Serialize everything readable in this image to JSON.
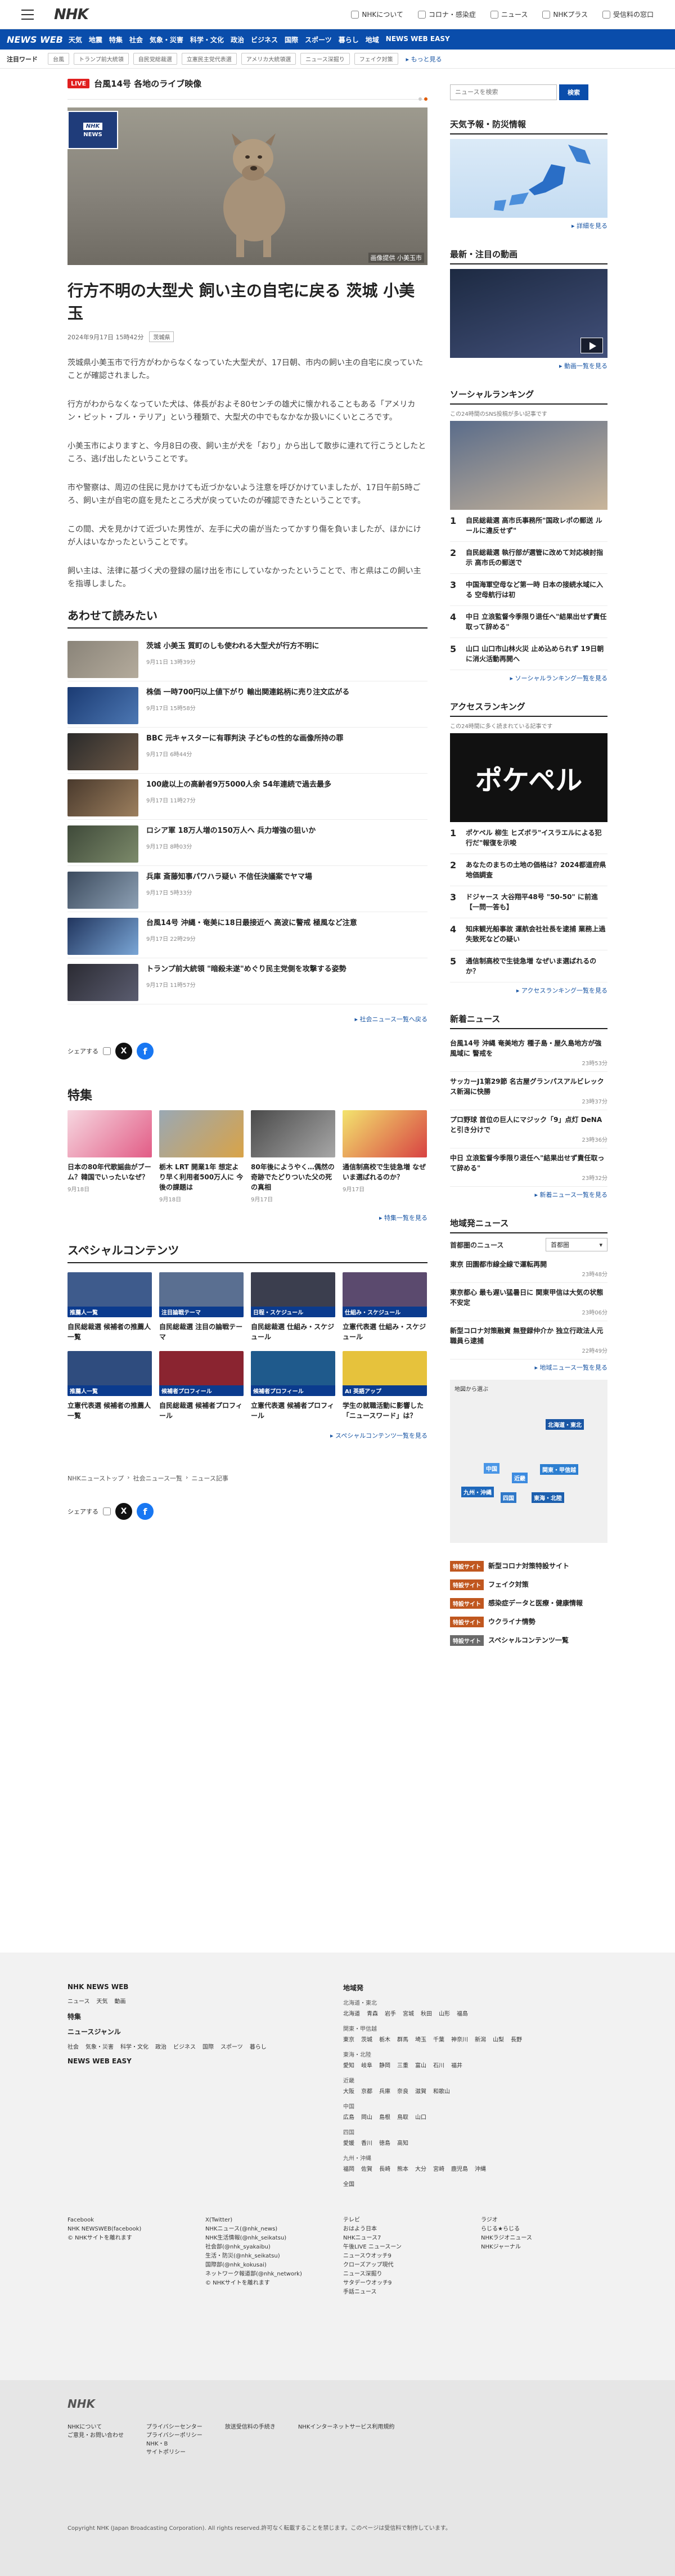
{
  "header": {
    "logo": "NHK",
    "links": [
      "NHKについて",
      "コロナ・感染症",
      "ニュース",
      "NHKプラス",
      "受信料の窓口"
    ]
  },
  "nav": {
    "logo": "NEWS WEB",
    "items": [
      "天気",
      "地震",
      "特集",
      "社会",
      "気象・災害",
      "科学・文化",
      "政治",
      "ビジネス",
      "国際",
      "スポーツ",
      "暮らし",
      "地域",
      "NEWS WEB EASY"
    ]
  },
  "trend": {
    "label": "注目ワード",
    "chips": [
      "台風",
      "トランプ前大統領",
      "自民党総裁選",
      "立憲民主党代表選",
      "アメリカ大統領選",
      "ニュース深掘り",
      "フェイク対策"
    ],
    "more": "もっと見る"
  },
  "live": {
    "badge": "LIVE",
    "title": "台風14号 各地のライブ映像"
  },
  "article": {
    "hero_credit": "画像提供 小美玉市",
    "headline": "行方不明の大型犬 飼い主の自宅に戻る 茨城 小美玉",
    "datetime": "2024年9月17日 15時42分",
    "tag": "茨城県",
    "paragraphs": [
      "茨城県小美玉市で行方がわからなくなっていた大型犬が、17日朝、市内の飼い主の自宅に戻っていたことが確認されました。",
      "行方がわからなくなっていた犬は、体長がおよそ80センチの雄犬に懐かれることもある「アメリカン・ピット・ブル・テリア」という種類で、大型犬の中でもなかなか扱いにくいところです。",
      "小美玉市によりますと、今月8日の夜、飼い主が犬を「おり」から出して散歩に連れて行こうとしたところ、逃げ出したということです。",
      "市や警察は、周辺の住民に見かけても近づかないよう注意を呼びかけていましたが、17日午前5時ごろ、飼い主が自宅の庭を見たところ犬が戻っていたのが確認できたということです。",
      "この間、犬を見かけて近づいた男性が、左手に犬の歯が当たってかすり傷を負いましたが、ほかにけが人はいなかったということです。",
      "飼い主は、法律に基づく犬の登録の届け出を市にしていなかったということで、市と県はこの飼い主を指導しました。"
    ]
  },
  "related": {
    "title": "あわせて読みたい",
    "items": [
      {
        "title": "茨城 小美玉 質町のしも使われる大型犬が行方不明に",
        "date": "9月11日 13時39分"
      },
      {
        "title": "株価 一時700円以上値下がり 輸出関連銘柄に売り注文広がる",
        "date": "9月17日 15時58分"
      },
      {
        "title": "BBC 元キャスターに有罪判決 子どもの性的な画像所持の罪",
        "date": "9月17日 6時44分"
      },
      {
        "title": "100歳以上の高齢者9万5000人余 54年連続で過去最多",
        "date": "9月17日 11時27分"
      },
      {
        "title": "ロシア軍 18万人増の150万人へ 兵力増強の狙いか",
        "date": "9月17日 8時03分"
      },
      {
        "title": "兵庫 斎藤知事パワハラ疑い 不信任決議案でヤマ場",
        "date": "9月17日 5時33分"
      },
      {
        "title": "台風14号 沖縄・奄美に18日最接近へ 高波に警戒 極風など注意",
        "date": "9月17日 22時29分"
      },
      {
        "title": "トランプ前大統領 \"暗殺未遂\"めぐり民主党側を攻撃する姿勢",
        "date": "9月17日 11時57分"
      }
    ],
    "more": "社会ニュース一覧へ戻る"
  },
  "share": {
    "label": "シェアする"
  },
  "features": {
    "title": "特集",
    "items": [
      {
        "text": "日本の80年代歌謡曲がブーム？韓国でいったいなぜ？",
        "date": "9月18日"
      },
      {
        "text": "栃木 LRT 開業1年 想定より早く利用者500万人に 今後の課題は",
        "date": "9月18日"
      },
      {
        "text": "80年後にようやく…偶然の奇跡でたどりついた父の死の真相",
        "date": "9月17日"
      },
      {
        "text": "通信制高校で生徒急増 なぜいま選ばれるのか？",
        "date": "9月17日"
      }
    ],
    "more": "特集一覧を見る"
  },
  "special": {
    "title": "スペシャルコンテンツ",
    "items": [
      {
        "overlay": "推薦人一覧",
        "text": "自民総裁選 候補者の推薦人一覧"
      },
      {
        "overlay": "注目論戦テーマ",
        "text": "自民総裁選 注目の論戦テーマ"
      },
      {
        "overlay": "日程・スケジュール",
        "text": "自民総裁選 仕組み・スケジュール"
      },
      {
        "overlay": "仕組み・スケジュール",
        "text": "立憲代表選 仕組み・スケジュール"
      },
      {
        "overlay": "推薦人一覧",
        "text": "立憲代表選 候補者の推薦人一覧"
      },
      {
        "overlay": "候補者プロフィール",
        "text": "自民総裁選 候補者プロフィール"
      },
      {
        "overlay": "候補者プロフィール",
        "text": "立憲代表選 候補者プロフィール"
      },
      {
        "overlay": "AI 英語アップ",
        "text": "学生の就職活動に影響した「ニュースワード」は？"
      }
    ],
    "more": "スペシャルコンテンツ一覧を見る"
  },
  "breadcrumb": [
    "NHKニューストップ",
    "社会ニュース一覧",
    "ニュース記事"
  ],
  "sidebar": {
    "search_placeholder": "ニュースを検索",
    "search_button": "検索",
    "weather": {
      "title": "天気予報・防災情報",
      "link": "詳細を見る"
    },
    "video": {
      "title": "最新・注目の動画",
      "link": "動画一覧を見る"
    },
    "social_ranking": {
      "title": "ソーシャルランキング",
      "sub": "この24時間のSNS投稿が多い記事です",
      "items": [
        "自民総裁選 高市氏事務所\"国政レポの郵送 ルールに違反せず\"",
        "自民総裁選 執行部が選管に改めて対応検討指示 高市氏の郵送で",
        "中国海軍空母など第一時 日本の接続水域に入る 空母航行は初",
        "中日 立浪監督今季限り退任へ\"結果出せず責任取って辞める\"",
        "山口 山口市山林火災 止め込められず 19日朝に消火活動再開へ"
      ],
      "link": "ソーシャルランキング一覧を見る"
    },
    "access_ranking": {
      "title": "アクセスランキング",
      "sub": "この24時間に多く読まれている記事です",
      "banner": "ポケペル",
      "items": [
        "ポケペル 柳生 ヒズボラ\"イスラエルによる犯行だ\"報復を示唆",
        "あなたのまちの土地の価格は？2024都道府県地価調査",
        "ドジャース 大谷翔平48号 \"50-50\" に前進【一問一答も】",
        "知床観光船事故 運航会社社長を逮捕 業務上過失致死などの疑い",
        "通信制高校で生徒急増 なぜいま選ばれるのか？"
      ],
      "link": "アクセスランキング一覧を見る"
    },
    "latest": {
      "title": "新着ニュース",
      "items": [
        {
          "t": "台風14号 沖縄 奄美地方 種子島・屋久島地方が強風域に 警戒を",
          "d": "23時53分"
        },
        {
          "t": "サッカーJ1第29節 名古屋グランパスアルビレックス新潟に快勝",
          "d": "23時37分"
        },
        {
          "t": "プロ野球 首位の巨人にマジック「9」点灯 DeNAと引き分けで",
          "d": "23時36分"
        },
        {
          "t": "中日 立浪監督今季限り退任へ\"結果出せず責任取って辞める\"",
          "d": "23時32分"
        }
      ],
      "link": "新着ニュース一覧を見る"
    },
    "local": {
      "title": "地域発ニュース",
      "label": "首都圏のニュース",
      "select": "首都圏",
      "items": [
        {
          "t": "東京 田園都市線全線で運転再開",
          "d": "23時48分"
        },
        {
          "t": "東京都心 最も遅い猛暑日に 関東甲信は大気の状態不安定",
          "d": "23時06分"
        },
        {
          "t": "新型コロナ対策融資 無登録仲介か 独立行政法人元職員ら逮捕",
          "d": "22時49分"
        }
      ],
      "link": "地域ニュース一覧を見る",
      "map_label": "地図から選ぶ",
      "regions": [
        "北海道・東北",
        "関東・甲信越",
        "近畿",
        "中国",
        "九州・沖縄",
        "四国",
        "東海・北陸"
      ]
    },
    "special_links": [
      {
        "tag": "特設サイト",
        "text": "新型コロナ対策特設サイト"
      },
      {
        "tag": "特設サイト",
        "text": "フェイク対策"
      },
      {
        "tag": "特設サイト",
        "text": "感染症データと医療・健康情報"
      },
      {
        "tag": "特設サイト",
        "text": "ウクライナ情勢"
      },
      {
        "tag": "特設サイト",
        "text": "スペシャルコンテンツ一覧"
      }
    ]
  },
  "footer": {
    "left_title": "NHK NEWS WEB",
    "left_row1": [
      "ニュース",
      "天気",
      "動画"
    ],
    "left_feat": "特集",
    "genre_title": "ニュースジャンル",
    "genres": [
      "社会",
      "気象・災害",
      "科学・文化",
      "政治",
      "ビジネス",
      "国際",
      "スポーツ",
      "暮らし"
    ],
    "easy": "NEWS WEB EASY",
    "region_title": "地域発",
    "regions": [
      {
        "h": "北海道・東北",
        "items": [
          "北海道",
          "青森",
          "岩手",
          "宮城",
          "秋田",
          "山形",
          "福島"
        ]
      },
      {
        "h": "関東・甲信越",
        "items": [
          "東京",
          "茨城",
          "栃木",
          "群馬",
          "埼玉",
          "千葉",
          "神奈川",
          "新潟",
          "山梨",
          "長野"
        ]
      },
      {
        "h": "東海・北陸",
        "items": [
          "愛知",
          "岐阜",
          "静岡",
          "三重",
          "富山",
          "石川",
          "福井"
        ]
      },
      {
        "h": "近畿",
        "items": [
          "大阪",
          "京都",
          "兵庫",
          "奈良",
          "滋賀",
          "和歌山"
        ]
      },
      {
        "h": "中国",
        "items": [
          "広島",
          "岡山",
          "島根",
          "鳥取",
          "山口"
        ]
      },
      {
        "h": "四国",
        "items": [
          "愛媛",
          "香川",
          "徳島",
          "高知"
        ]
      },
      {
        "h": "九州・沖縄",
        "items": [
          "福岡",
          "佐賀",
          "長崎",
          "熊本",
          "大分",
          "宮崎",
          "鹿児島",
          "沖縄"
        ]
      }
    ],
    "all": "全国",
    "social": [
      "Facebook\nNHK NEWSWEB(facebook)\n© NHKサイトを離れます",
      "X(Twitter)\nNHKニュース(@nhk_news)\nNHK生活情報(@nhk_seikatsu)\n社会部(@nhk_syakaibu)\n生活・防災(@nhk_seikatsu)\n国際部(@nhk_kokusai)\nネットワーク報道部(@nhk_network)\n© NHKサイトを離れます",
      "テレビ\nおはよう日本\nNHKニュース7\n午後LIVE ニュースーン\nニュースウオッチ9\nクローズアップ現代\nニュース深掘り\nサタデーウオッチ9\n手話ニュース",
      "ラジオ\nらじる★らじる\nNHKラジオニュース\nNHKジャーナル"
    ],
    "bottom_logo": "NHK",
    "bottom_links": [
      "NHKについて\nご意見・お問い合わせ",
      "プライバシーセンター\nプライバシーポリシー\nNHK・B\nサイトポリシー",
      "放送受信料の手続き",
      "NHKインターネットサービス利用規約"
    ],
    "copyright": "Copyright NHK (Japan Broadcasting Corporation). All rights reserved.許可なく転載することを禁じます。このページは受信料で制作しています。"
  },
  "colors": {
    "brand": "#0a4dab",
    "live": "#e02020",
    "accent": "#e05a00"
  }
}
